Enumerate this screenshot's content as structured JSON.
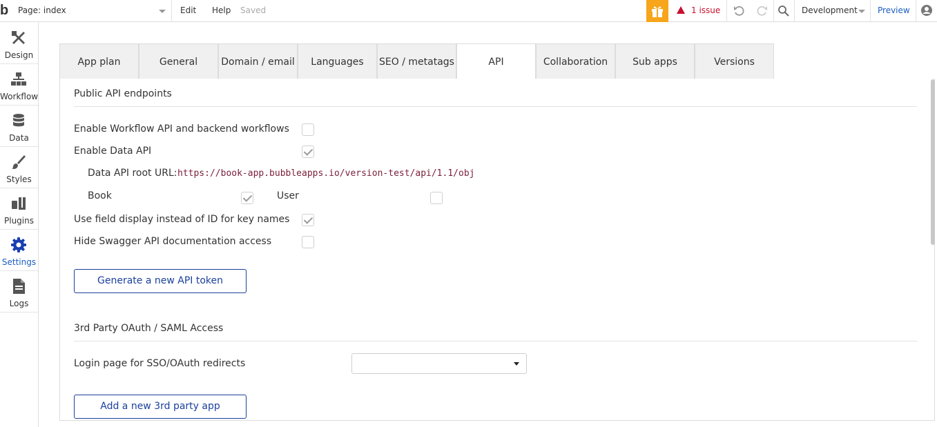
{
  "topbar": {
    "logo": "b",
    "page_select": "Page: index",
    "menu": [
      "Edit",
      "Help"
    ],
    "status": "Saved",
    "issues": "1 issue",
    "environment": "Development",
    "preview": "Preview",
    "accent_color": "#f7a51b",
    "issue_color": "#c8102e"
  },
  "sidebar": {
    "items": [
      {
        "label": "Design",
        "icon": "design-tools-icon"
      },
      {
        "label": "Workflow",
        "icon": "workflow-icon"
      },
      {
        "label": "Data",
        "icon": "database-icon"
      },
      {
        "label": "Styles",
        "icon": "brush-icon"
      },
      {
        "label": "Plugins",
        "icon": "plug-icon"
      },
      {
        "label": "Settings",
        "icon": "gear-icon"
      },
      {
        "label": "Logs",
        "icon": "document-icon"
      }
    ],
    "active": "Settings",
    "active_color": "#1a5ec1"
  },
  "tabs": {
    "items": [
      "App plan",
      "General",
      "Domain / email",
      "Languages",
      "SEO / metatags",
      "API",
      "Collaboration",
      "Sub apps",
      "Versions"
    ],
    "active": "API"
  },
  "api": {
    "public_title": "Public API endpoints",
    "enable_workflow_api": {
      "label": "Enable Workflow API and backend workflows",
      "checked": false
    },
    "enable_data_api": {
      "label": "Enable Data API",
      "checked": true
    },
    "root_url_label": "Data API root URL:",
    "root_url": "https://book-app.bubbleapps.io/version-test/api/1.1/obj",
    "types": [
      {
        "label": "Book",
        "checked": true
      },
      {
        "label": "User",
        "checked": false
      }
    ],
    "field_display": {
      "label": "Use field display instead of ID for key names",
      "checked": true
    },
    "hide_swagger": {
      "label": "Hide Swagger API documentation access",
      "checked": false
    },
    "generate_token_button": "Generate a new API token",
    "oauth_title": "3rd Party OAuth / SAML Access",
    "login_page_label": "Login page for SSO/OAuth redirects",
    "login_page_value": "",
    "add_app_button": "Add a new 3rd party app"
  }
}
